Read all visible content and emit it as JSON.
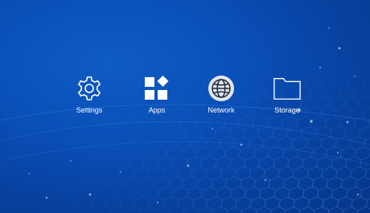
{
  "colors": {
    "background": "#0a4fb8",
    "icon": "#ffffff",
    "label": "#ffffff"
  },
  "menu": {
    "items": [
      {
        "label": "Settings",
        "icon": "gear-icon"
      },
      {
        "label": "Apps",
        "icon": "apps-grid-icon"
      },
      {
        "label": "Network",
        "icon": "globe-icon"
      },
      {
        "label": "Storage",
        "icon": "folder-icon"
      }
    ]
  }
}
